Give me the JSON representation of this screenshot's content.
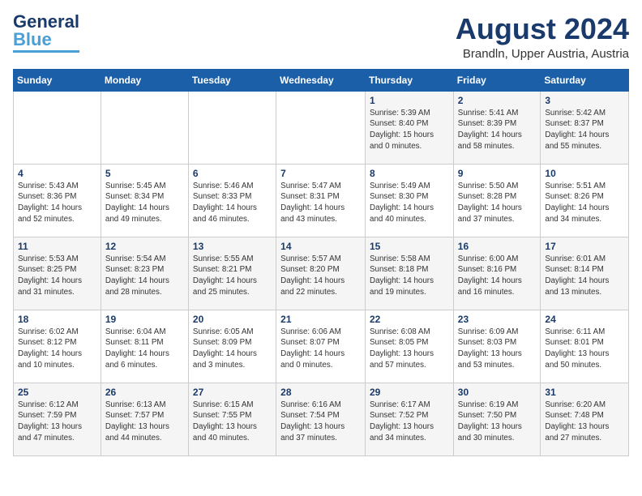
{
  "header": {
    "logo_general": "General",
    "logo_blue": "Blue",
    "month_title": "August 2024",
    "location": "Brandln, Upper Austria, Austria"
  },
  "days_of_week": [
    "Sunday",
    "Monday",
    "Tuesday",
    "Wednesday",
    "Thursday",
    "Friday",
    "Saturday"
  ],
  "weeks": [
    [
      {
        "day": "",
        "info": ""
      },
      {
        "day": "",
        "info": ""
      },
      {
        "day": "",
        "info": ""
      },
      {
        "day": "",
        "info": ""
      },
      {
        "day": "1",
        "info": "Sunrise: 5:39 AM\nSunset: 8:40 PM\nDaylight: 15 hours\nand 0 minutes."
      },
      {
        "day": "2",
        "info": "Sunrise: 5:41 AM\nSunset: 8:39 PM\nDaylight: 14 hours\nand 58 minutes."
      },
      {
        "day": "3",
        "info": "Sunrise: 5:42 AM\nSunset: 8:37 PM\nDaylight: 14 hours\nand 55 minutes."
      }
    ],
    [
      {
        "day": "4",
        "info": "Sunrise: 5:43 AM\nSunset: 8:36 PM\nDaylight: 14 hours\nand 52 minutes."
      },
      {
        "day": "5",
        "info": "Sunrise: 5:45 AM\nSunset: 8:34 PM\nDaylight: 14 hours\nand 49 minutes."
      },
      {
        "day": "6",
        "info": "Sunrise: 5:46 AM\nSunset: 8:33 PM\nDaylight: 14 hours\nand 46 minutes."
      },
      {
        "day": "7",
        "info": "Sunrise: 5:47 AM\nSunset: 8:31 PM\nDaylight: 14 hours\nand 43 minutes."
      },
      {
        "day": "8",
        "info": "Sunrise: 5:49 AM\nSunset: 8:30 PM\nDaylight: 14 hours\nand 40 minutes."
      },
      {
        "day": "9",
        "info": "Sunrise: 5:50 AM\nSunset: 8:28 PM\nDaylight: 14 hours\nand 37 minutes."
      },
      {
        "day": "10",
        "info": "Sunrise: 5:51 AM\nSunset: 8:26 PM\nDaylight: 14 hours\nand 34 minutes."
      }
    ],
    [
      {
        "day": "11",
        "info": "Sunrise: 5:53 AM\nSunset: 8:25 PM\nDaylight: 14 hours\nand 31 minutes."
      },
      {
        "day": "12",
        "info": "Sunrise: 5:54 AM\nSunset: 8:23 PM\nDaylight: 14 hours\nand 28 minutes."
      },
      {
        "day": "13",
        "info": "Sunrise: 5:55 AM\nSunset: 8:21 PM\nDaylight: 14 hours\nand 25 minutes."
      },
      {
        "day": "14",
        "info": "Sunrise: 5:57 AM\nSunset: 8:20 PM\nDaylight: 14 hours\nand 22 minutes."
      },
      {
        "day": "15",
        "info": "Sunrise: 5:58 AM\nSunset: 8:18 PM\nDaylight: 14 hours\nand 19 minutes."
      },
      {
        "day": "16",
        "info": "Sunrise: 6:00 AM\nSunset: 8:16 PM\nDaylight: 14 hours\nand 16 minutes."
      },
      {
        "day": "17",
        "info": "Sunrise: 6:01 AM\nSunset: 8:14 PM\nDaylight: 14 hours\nand 13 minutes."
      }
    ],
    [
      {
        "day": "18",
        "info": "Sunrise: 6:02 AM\nSunset: 8:12 PM\nDaylight: 14 hours\nand 10 minutes."
      },
      {
        "day": "19",
        "info": "Sunrise: 6:04 AM\nSunset: 8:11 PM\nDaylight: 14 hours\nand 6 minutes."
      },
      {
        "day": "20",
        "info": "Sunrise: 6:05 AM\nSunset: 8:09 PM\nDaylight: 14 hours\nand 3 minutes."
      },
      {
        "day": "21",
        "info": "Sunrise: 6:06 AM\nSunset: 8:07 PM\nDaylight: 14 hours\nand 0 minutes."
      },
      {
        "day": "22",
        "info": "Sunrise: 6:08 AM\nSunset: 8:05 PM\nDaylight: 13 hours\nand 57 minutes."
      },
      {
        "day": "23",
        "info": "Sunrise: 6:09 AM\nSunset: 8:03 PM\nDaylight: 13 hours\nand 53 minutes."
      },
      {
        "day": "24",
        "info": "Sunrise: 6:11 AM\nSunset: 8:01 PM\nDaylight: 13 hours\nand 50 minutes."
      }
    ],
    [
      {
        "day": "25",
        "info": "Sunrise: 6:12 AM\nSunset: 7:59 PM\nDaylight: 13 hours\nand 47 minutes."
      },
      {
        "day": "26",
        "info": "Sunrise: 6:13 AM\nSunset: 7:57 PM\nDaylight: 13 hours\nand 44 minutes."
      },
      {
        "day": "27",
        "info": "Sunrise: 6:15 AM\nSunset: 7:55 PM\nDaylight: 13 hours\nand 40 minutes."
      },
      {
        "day": "28",
        "info": "Sunrise: 6:16 AM\nSunset: 7:54 PM\nDaylight: 13 hours\nand 37 minutes."
      },
      {
        "day": "29",
        "info": "Sunrise: 6:17 AM\nSunset: 7:52 PM\nDaylight: 13 hours\nand 34 minutes."
      },
      {
        "day": "30",
        "info": "Sunrise: 6:19 AM\nSunset: 7:50 PM\nDaylight: 13 hours\nand 30 minutes."
      },
      {
        "day": "31",
        "info": "Sunrise: 6:20 AM\nSunset: 7:48 PM\nDaylight: 13 hours\nand 27 minutes."
      }
    ]
  ]
}
